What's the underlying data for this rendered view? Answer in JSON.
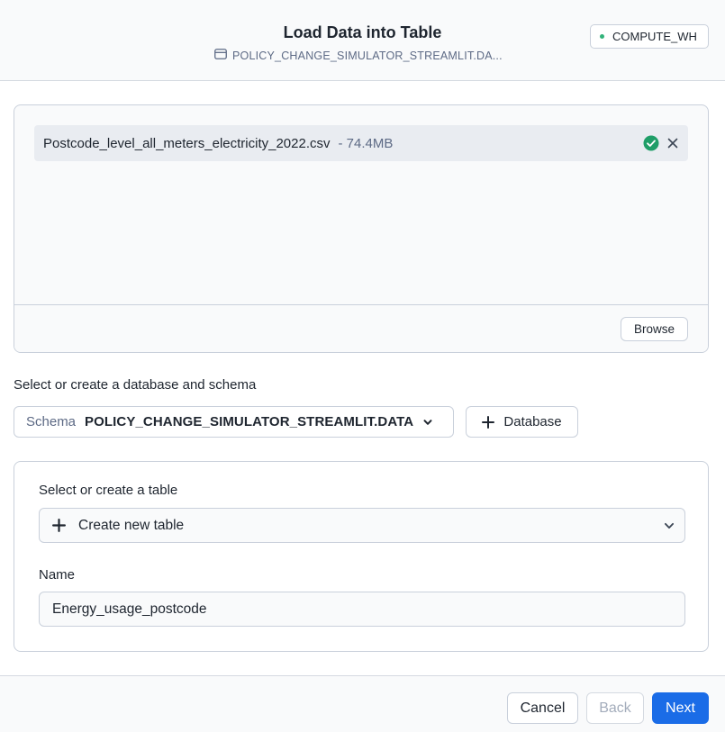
{
  "header": {
    "title": "Load Data into Table",
    "subtitle": "POLICY_CHANGE_SIMULATOR_STREAMLIT.DA...",
    "warehouse": "COMPUTE_WH"
  },
  "upload": {
    "file_name": "Postcode_level_all_meters_electricity_2022.csv",
    "file_size": "- 74.4MB",
    "browse_label": "Browse"
  },
  "database": {
    "section_label": "Select or create a database and schema",
    "schema_prefix": "Schema",
    "schema_value": "POLICY_CHANGE_SIMULATOR_STREAMLIT.DATA",
    "add_database_label": "Database"
  },
  "table": {
    "section_label": "Select or create a table",
    "selected_option": "Create new table",
    "name_label": "Name",
    "name_value": "Energy_usage_postcode"
  },
  "footer": {
    "cancel_label": "Cancel",
    "back_label": "Back",
    "next_label": "Next"
  },
  "colors": {
    "primary": "#1a6ce7",
    "success": "#1f9e68",
    "warehouse_dot": "#32b37a"
  },
  "icons": {
    "subtitle": "table-icon",
    "file_status": "check-circle-icon",
    "file_remove": "close-icon",
    "schema_dropdown": "chevron-down-icon",
    "add": "plus-icon"
  }
}
